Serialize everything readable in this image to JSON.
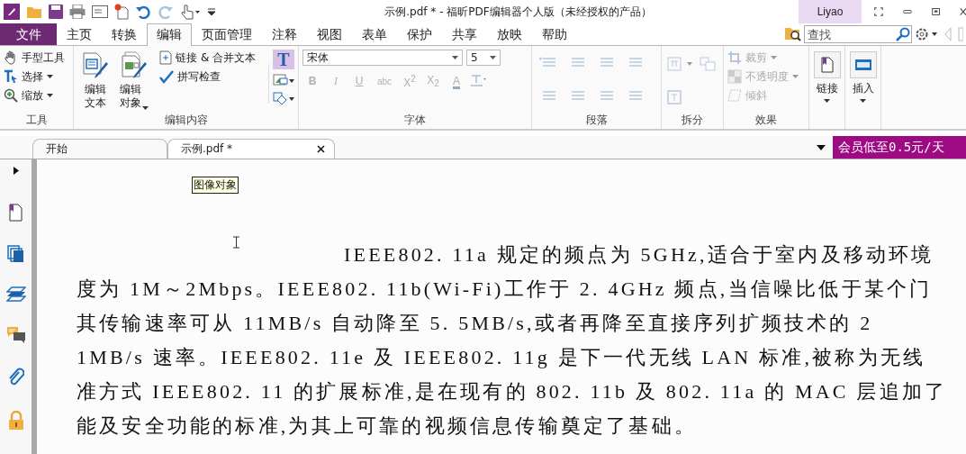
{
  "title_bar": {
    "title": "示例.pdf * - 福昕PDF编辑器个人版（未经授权的产品）",
    "user": "Liyao"
  },
  "menu_tabs": [
    {
      "label": "文件",
      "kind": "file",
      "selected": false
    },
    {
      "label": "主页",
      "kind": "tab",
      "selected": false
    },
    {
      "label": "转换",
      "kind": "tab",
      "selected": false
    },
    {
      "label": "编辑",
      "kind": "tab",
      "selected": true
    },
    {
      "label": "页面管理",
      "kind": "tab",
      "selected": false
    },
    {
      "label": "注释",
      "kind": "tab",
      "selected": false
    },
    {
      "label": "视图",
      "kind": "tab",
      "selected": false
    },
    {
      "label": "表单",
      "kind": "tab",
      "selected": false
    },
    {
      "label": "保护",
      "kind": "tab",
      "selected": false
    },
    {
      "label": "共享",
      "kind": "tab",
      "selected": false
    },
    {
      "label": "放映",
      "kind": "tab",
      "selected": false
    },
    {
      "label": "帮助",
      "kind": "tab",
      "selected": false
    }
  ],
  "search": {
    "placeholder": "查找"
  },
  "ribbon": {
    "tools": {
      "group_label": "工具",
      "items": [
        {
          "label": "手型工具",
          "kind": "hand",
          "menu": false
        },
        {
          "label": "选择",
          "kind": "select",
          "menu": true
        },
        {
          "label": "缩放",
          "kind": "zoom",
          "menu": true
        }
      ]
    },
    "edit_content": {
      "group_label": "编辑内容",
      "big_buttons": [
        {
          "label": "编辑文本",
          "kind": "text",
          "menu": false
        },
        {
          "label": "编辑对象",
          "kind": "object",
          "menu": true
        }
      ],
      "links": [
        {
          "label": "链接 & 合并文本",
          "kind": "join"
        },
        {
          "label": "拼写检查",
          "kind": "spell"
        }
      ],
      "text_tool": {
        "label": "T",
        "on": true
      }
    },
    "font": {
      "group_label": "字体",
      "font_name": "宋体",
      "font_size": "5",
      "format_buttons": [
        {
          "label": "B",
          "kind": "bold",
          "disabled": true
        },
        {
          "label": "I",
          "kind": "italic",
          "disabled": true
        },
        {
          "label": "U",
          "kind": "underline",
          "disabled": true
        },
        {
          "label": "abc",
          "kind": "strike",
          "disabled": true
        },
        {
          "label": "X$^{2}$",
          "kind": "plain",
          "disabled": true
        },
        {
          "label": "X$_{2}$",
          "kind": "plain",
          "disabled": true
        },
        {
          "label": "A",
          "kind": "color",
          "disabled": true
        }
      ]
    },
    "paragraph": {
      "group_label": "段落"
    },
    "split": {
      "group_label": "拆分"
    },
    "effects": {
      "group_label": "效果",
      "items": [
        {
          "label": "裁剪",
          "kind": "crop",
          "disabled": true,
          "menu": true
        },
        {
          "label": "不透明度",
          "kind": "opacity",
          "disabled": true,
          "menu": true
        },
        {
          "label": "倾斜",
          "kind": "skew",
          "disabled": true,
          "menu": false
        }
      ]
    },
    "big_buttons": [
      {
        "label": "链接",
        "kind": "link"
      },
      {
        "label": "插入",
        "kind": "insert"
      }
    ]
  },
  "doc_tabs": [
    {
      "label": "开始",
      "selected": false,
      "closable": false
    },
    {
      "label": "示例.pdf *",
      "selected": true,
      "closable": true
    }
  ],
  "promo": "会员低至0.5元/天",
  "tooltip": "图像对象",
  "document": {
    "lines": [
      "IEEE802. 11a 规定的频点为 5GHz,适合于室内及移动环境",
      "度为 1M～2Mbps。IEEE802. 11b(Wi-Fi)工作于 2. 4GHz 频点,当信噪比低于某个门",
      "其传输速率可从 11MB/s 自动降至 5. 5MB/s,或者再降至直接序列扩频技术的 2",
      "1MB/s 速率。IEEE802. 11e 及 IEEE802. 11g 是下一代无线 LAN 标准,被称为无线",
      "准方式 IEEE802. 11 的扩展标准,是在现有的 802. 11b 及 802. 11a 的 MAC 层追加了",
      "能及安全功能的标准,为其上可靠的视频信息传输奠定了基础。"
    ]
  }
}
